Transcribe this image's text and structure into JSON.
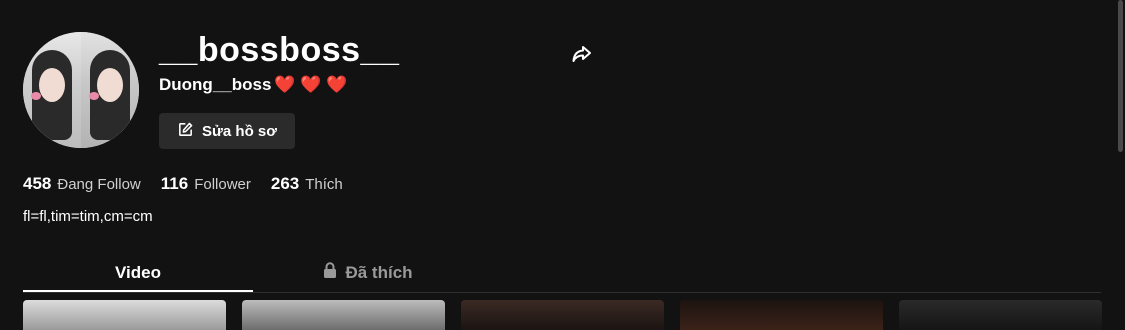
{
  "profile": {
    "username": "__bossboss__",
    "nickname": "Duong__boss",
    "nickname_hearts": "❤️ ❤️ ❤️",
    "edit_button_label": "Sửa hồ sơ",
    "bio": "fl=fl,tim=tim,cm=cm"
  },
  "stats": [
    {
      "value": "458",
      "label": "Đang Follow"
    },
    {
      "value": "116",
      "label": "Follower"
    },
    {
      "value": "263",
      "label": "Thích"
    }
  ],
  "tabs": [
    {
      "label": "Video",
      "active": true
    },
    {
      "label": "Đã thích",
      "active": false,
      "icon": "lock-icon"
    }
  ],
  "icons": {
    "share": "share-arrow-icon",
    "edit": "edit-icon",
    "lock": "lock-icon"
  },
  "colors": {
    "background": "#121212",
    "heart": "#e0142b",
    "button_bg": "#2b2b2b"
  }
}
